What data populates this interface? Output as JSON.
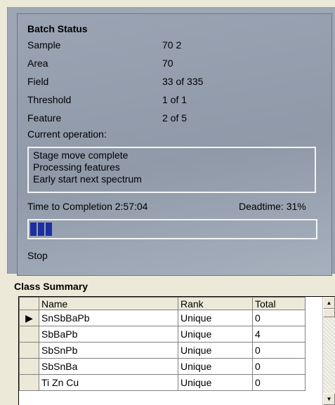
{
  "batch": {
    "title": "Batch Status",
    "rows": [
      {
        "label": "Sample",
        "value": "70  2"
      },
      {
        "label": "Area",
        "value": "70"
      },
      {
        "label": "Field",
        "value": "33 of 335"
      },
      {
        "label": "Threshold",
        "value": "1 of 1"
      },
      {
        "label": "Feature",
        "value": "2 of 5"
      }
    ],
    "current_op_label": "Current operation:",
    "operations": [
      "Stage move complete",
      "Processing features",
      "Early start next spectrum"
    ],
    "time_to_completion": "Time to Completion 2:57:04",
    "deadtime": "Deadtime: 31%",
    "progress_segments": 3,
    "progress_color": "#1c2fa0",
    "stop_label": "Stop"
  },
  "class_summary": {
    "title": "Class Summary",
    "columns": [
      "Name",
      "Rank",
      "Total"
    ],
    "rows": [
      {
        "name": "SnSbBaPb",
        "rank": "Unique",
        "total": "0",
        "selected": true
      },
      {
        "name": "SbBaPb",
        "rank": "Unique",
        "total": "4",
        "selected": false
      },
      {
        "name": "SbSnPb",
        "rank": "Unique",
        "total": "0",
        "selected": false
      },
      {
        "name": "SbSnBa",
        "rank": "Unique",
        "total": "0",
        "selected": false
      },
      {
        "name": "Ti Zn Cu",
        "rank": "Unique",
        "total": "0",
        "selected": false
      }
    ]
  }
}
